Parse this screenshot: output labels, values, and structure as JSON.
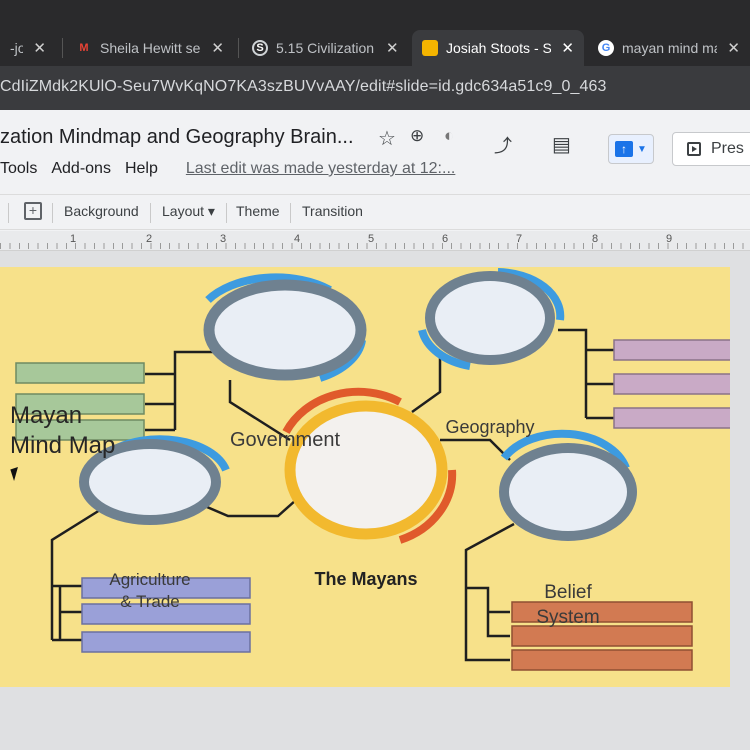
{
  "tabs": [
    {
      "title": "-jo",
      "favicon": "doc-icon",
      "active": false
    },
    {
      "title": "Sheila Hewitt se",
      "favicon": "gmail-icon",
      "active": false
    },
    {
      "title": "5.15 Civilization",
      "favicon": "schoology-icon",
      "active": false
    },
    {
      "title": "Josiah Stoots - S",
      "favicon": "slides-icon",
      "active": true
    },
    {
      "title": "mayan mind ma",
      "favicon": "google-icon",
      "active": false
    }
  ],
  "address": "CdIiZMdk2KUlO-Seu7WvKqNO7KA3szBUVvAAY/edit#slide=id.gdc634a51c9_0_463",
  "doc": {
    "title": "zation Mindmap and Geography Brain...",
    "menu": [
      "Tools",
      "Add-ons",
      "Help"
    ],
    "last_edit": "Last edit was made yesterday at 12:...",
    "present_label": "Pres"
  },
  "toolbar": {
    "background": "Background",
    "layout": "Layout ▾",
    "theme": "Theme",
    "transition": "Transition"
  },
  "ruler": [
    "1",
    "2",
    "3",
    "4",
    "5",
    "6",
    "7",
    "8",
    "9"
  ],
  "slide": {
    "title": "Mayan\nMind Map",
    "center": "The Mayans",
    "government": "Government",
    "geography": "Geography",
    "agriculture": "Agriculture\n& Trade",
    "belief": "Belief\nSystem"
  },
  "colors": {
    "slide_bg": "#f7e18a",
    "ring_gray": "#6f8190",
    "ring_blue": "#3d9be0",
    "center_ring": "#f2b92e",
    "center_arc": "#e05a2b",
    "box_green": "#a7c89a",
    "box_pink": "#c9aac6",
    "box_blue": "#9aa0d8",
    "box_orange": "#d27a52"
  }
}
